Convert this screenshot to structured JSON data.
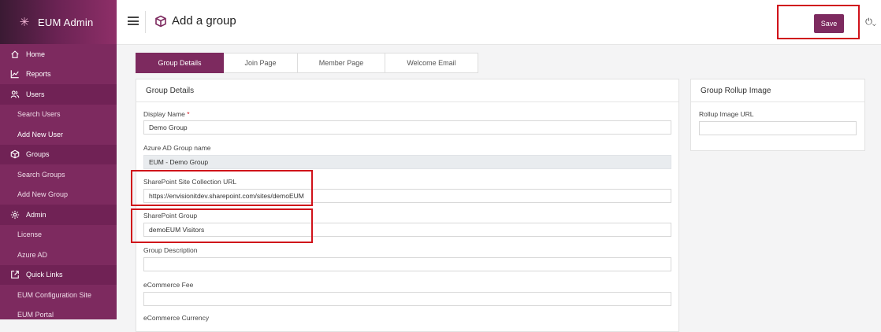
{
  "app": {
    "title": "EUM Admin"
  },
  "sidebar": {
    "items": [
      {
        "label": "Home",
        "type": "main",
        "icon": "home-icon"
      },
      {
        "label": "Reports",
        "type": "main",
        "icon": "chart-icon"
      },
      {
        "label": "Users",
        "type": "section",
        "icon": "users-icon"
      },
      {
        "label": "Search Users",
        "type": "sub"
      },
      {
        "label": "Add New User",
        "type": "sub-active"
      },
      {
        "label": "Groups",
        "type": "section",
        "icon": "cube-icon"
      },
      {
        "label": "Search Groups",
        "type": "sub"
      },
      {
        "label": "Add New Group",
        "type": "sub"
      },
      {
        "label": "Admin",
        "type": "section",
        "icon": "gear-icon"
      },
      {
        "label": "License",
        "type": "sub"
      },
      {
        "label": "Azure AD",
        "type": "sub"
      },
      {
        "label": "Quick Links",
        "type": "section",
        "icon": "external-link-icon"
      },
      {
        "label": "EUM Configuration Site",
        "type": "sub"
      },
      {
        "label": "EUM Portal",
        "type": "sub"
      }
    ]
  },
  "header": {
    "title": "Add a group",
    "save_label": "Save"
  },
  "tabs": [
    "Group Details",
    "Join Page",
    "Member Page",
    "Welcome Email"
  ],
  "group_details": {
    "title": "Group Details",
    "display_name_label": "Display Name",
    "required_mark": "*",
    "display_name_value": "Demo Group",
    "azure_label": "Azure AD Group name",
    "azure_value": "EUM - Demo Group",
    "sp_url_label": "SharePoint Site Collection URL",
    "sp_url_value": "https://envisionitdev.sharepoint.com/sites/demoEUM",
    "sp_group_label": "SharePoint Group",
    "sp_group_value": "demoEUM Visitors",
    "description_label": "Group Description",
    "description_value": "",
    "fee_label": "eCommerce Fee",
    "fee_value": "",
    "currency_label": "eCommerce Currency"
  },
  "rollup": {
    "title": "Group Rollup Image",
    "url_label": "Rollup Image URL",
    "url_value": ""
  },
  "colors": {
    "accent": "#7d2a5f",
    "highlight": "#d0121a"
  }
}
